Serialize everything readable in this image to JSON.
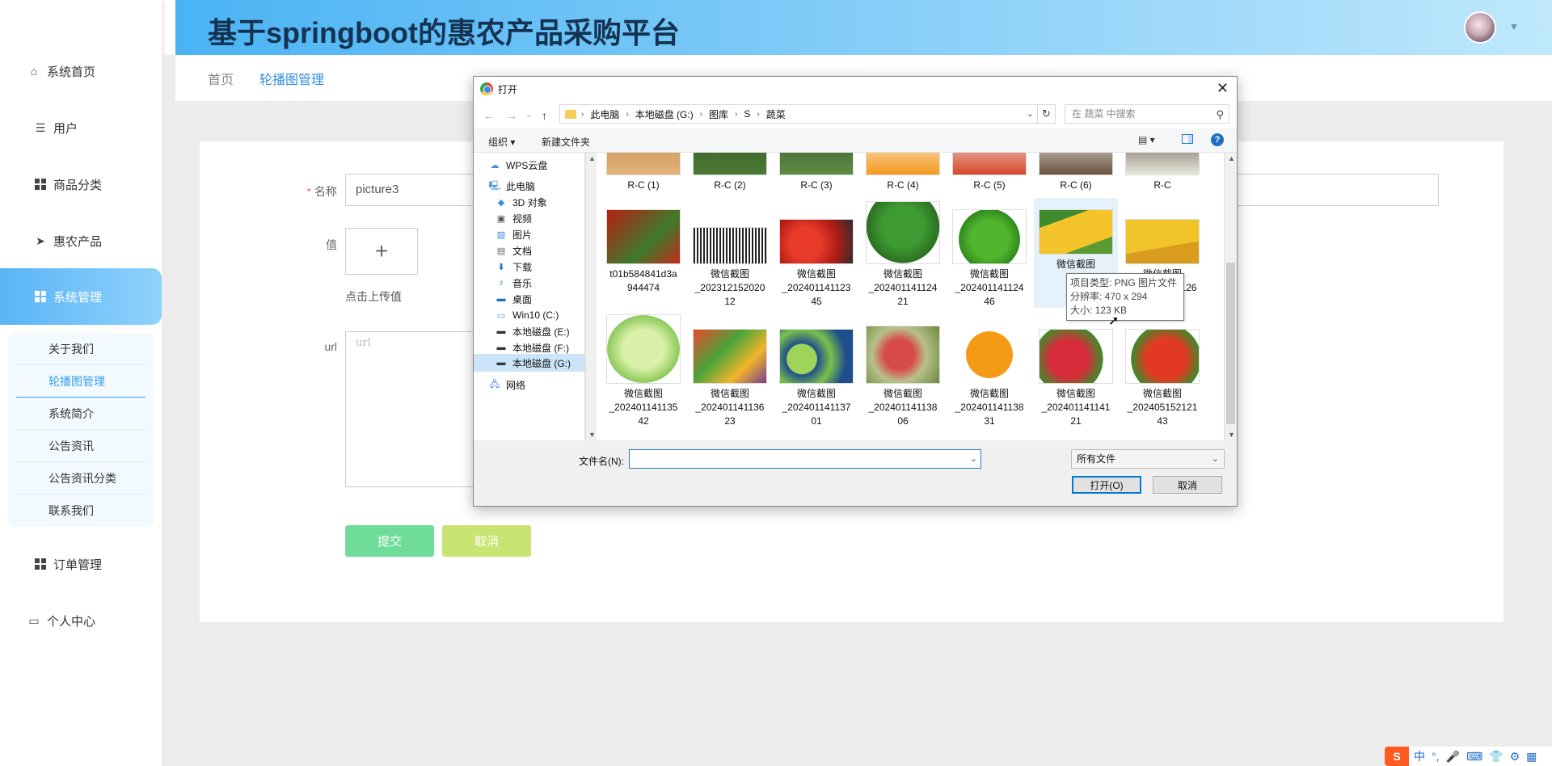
{
  "header": {
    "title": "基于springboot的惠农产品采购平台"
  },
  "sidebar": {
    "items": [
      {
        "label": "系统首页"
      },
      {
        "label": "用户"
      },
      {
        "label": "商品分类"
      },
      {
        "label": "惠农产品"
      },
      {
        "label": "系统管理"
      },
      {
        "label": "订单管理"
      },
      {
        "label": "个人中心"
      }
    ],
    "submenu": [
      {
        "label": "关于我们"
      },
      {
        "label": "轮播图管理"
      },
      {
        "label": "系统简介"
      },
      {
        "label": "公告资讯"
      },
      {
        "label": "公告资讯分类"
      },
      {
        "label": "联系我们"
      }
    ]
  },
  "breadcrumb": {
    "home": "首页",
    "current": "轮播图管理"
  },
  "form": {
    "name_label": "名称",
    "name_value": "picture3",
    "value_label": "值",
    "upload_plus": "+",
    "upload_hint": "点击上传值",
    "url_label": "url",
    "url_placeholder": "url",
    "submit": "提交",
    "cancel": "取消"
  },
  "dialog": {
    "title": "打开",
    "close": "✕",
    "path": [
      "此电脑",
      "本地磁盘 (G:)",
      "图库",
      "S",
      "蔬菜"
    ],
    "search_placeholder": "在 蔬菜 中搜索",
    "organize": "组织 ▾",
    "new_folder": "新建文件夹",
    "help": "?",
    "tree": [
      {
        "label": "WPS云盘",
        "icon": "cloud-icon"
      },
      {
        "label": "此电脑",
        "icon": "computer-icon"
      },
      {
        "label": "3D 对象",
        "icon": "cube-icon"
      },
      {
        "label": "视频",
        "icon": "video-icon"
      },
      {
        "label": "图片",
        "icon": "picture-icon"
      },
      {
        "label": "文档",
        "icon": "document-icon"
      },
      {
        "label": "下载",
        "icon": "download-icon"
      },
      {
        "label": "音乐",
        "icon": "music-icon"
      },
      {
        "label": "桌面",
        "icon": "desktop-icon"
      },
      {
        "label": "Win10 (C:)",
        "icon": "drive-icon"
      },
      {
        "label": "本地磁盘 (E:)",
        "icon": "drive-icon"
      },
      {
        "label": "本地磁盘 (F:)",
        "icon": "drive-icon"
      },
      {
        "label": "本地磁盘 (G:)",
        "icon": "drive-icon"
      },
      {
        "label": "网络",
        "icon": "network-icon"
      }
    ],
    "files_row1": [
      "R-C (1)",
      "R-C (2)",
      "R-C (3)",
      "R-C (4)",
      "R-C (5)",
      "R-C (6)",
      "R-C"
    ],
    "files_row2": [
      [
        "t01b584841d3a",
        "944474"
      ],
      [
        "微信截图",
        "_202312152020",
        "12"
      ],
      [
        "微信截图",
        "_202401141123",
        "45"
      ],
      [
        "微信截图",
        "_202401141124",
        "21"
      ],
      [
        "微信截图",
        "_202401141124",
        "46"
      ],
      [
        "微信截图",
        "_20",
        ""
      ],
      [
        "微信截图",
        "_202401141126",
        ""
      ]
    ],
    "files_row3": [
      [
        "微信截图",
        "_202401141135",
        "42"
      ],
      [
        "微信截图",
        "_202401141136",
        "23"
      ],
      [
        "微信截图",
        "_202401141137",
        "01"
      ],
      [
        "微信截图",
        "_202401141138",
        "06"
      ],
      [
        "微信截图",
        "_202401141138",
        "31"
      ],
      [
        "微信截图",
        "_202401141141",
        "21"
      ],
      [
        "微信截图",
        "_202405152121",
        "43"
      ]
    ],
    "tooltip": [
      "项目类型: PNG 图片文件",
      "分辨率: 470 x 294",
      "大小: 123 KB"
    ],
    "filename_label": "文件名(N):",
    "filetype": "所有文件",
    "open": "打开(O)",
    "cancel": "取消"
  },
  "ime": {
    "labels": [
      "中",
      "°,",
      "🎤",
      "⌨",
      "👕",
      "⚙",
      "▦"
    ]
  }
}
